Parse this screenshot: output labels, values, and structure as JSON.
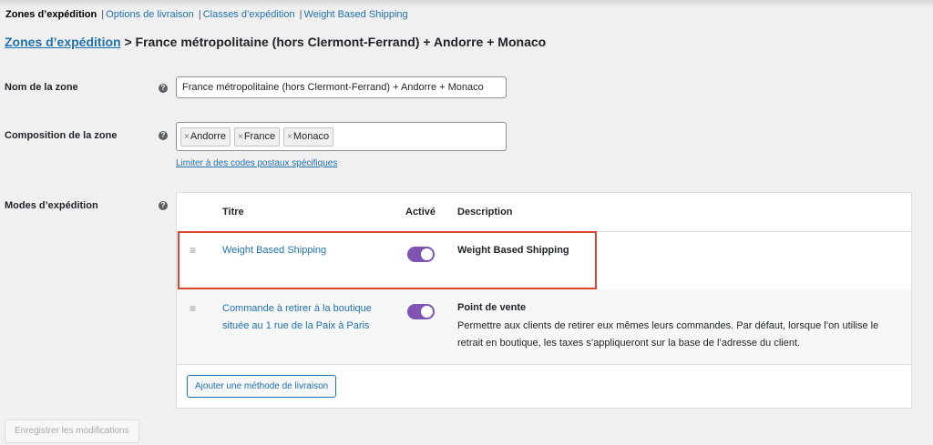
{
  "nav": {
    "current": "Zones d’expédition",
    "links": [
      "Options de livraison",
      "Classes d’expédition",
      "Weight Based Shipping"
    ],
    "separator": "|"
  },
  "breadcrumb": {
    "link": "Zones d’expédition",
    "rest": " > France métropolitaine (hors Clermont-Ferrand) + Andorre + Monaco"
  },
  "help_glyph": "?",
  "zone_name": {
    "label": "Nom de la zone",
    "value": "France métropolitaine (hors Clermont-Ferrand) + Andorre + Monaco"
  },
  "zone_regions": {
    "label": "Composition de la zone",
    "remove_glyph": "×",
    "tags": [
      "Andorre",
      "France",
      "Monaco"
    ],
    "limit_link": "Limiter à des codes postaux spécifiques"
  },
  "methods": {
    "label": "Modes d’expédition",
    "columns": {
      "title": "Titre",
      "enabled": "Activé",
      "description": "Description"
    },
    "drag_glyph": "≡",
    "rows": [
      {
        "title": "Weight Based Shipping",
        "enabled": true,
        "desc_title": "Weight Based Shipping",
        "desc": ""
      },
      {
        "title": "Commande à retirer à la boutique située au 1 rue de la Paix à Paris",
        "enabled": true,
        "desc_title": "Point de vente",
        "desc": "Permettre aux clients de retirer eux mêmes leurs commandes. Par défaut, lorsque l’on utilise le retrait en boutique, les taxes s’appliqueront sur la base de l’adresse du client."
      }
    ],
    "add_button": "Ajouter une méthode de livraison"
  },
  "save_button": "Enregistrer les modifications",
  "colors": {
    "link": "#2271b1",
    "toggle_on": "#7f54b3",
    "highlight": "#e0442e"
  }
}
